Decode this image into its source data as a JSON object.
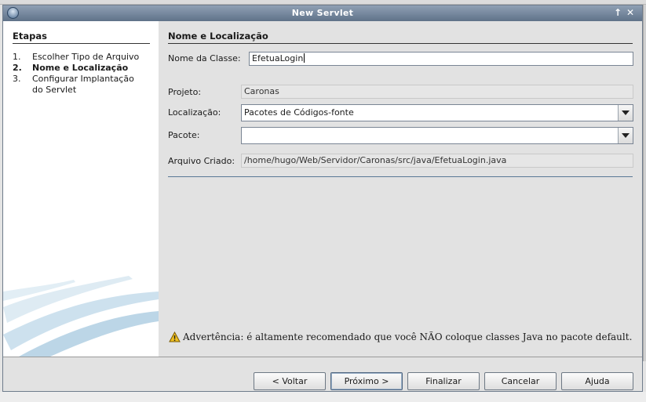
{
  "window": {
    "title": "New Servlet",
    "controls": {
      "maximize": "↑",
      "close": "✕"
    }
  },
  "steps": {
    "title": "Etapas",
    "items": [
      {
        "num": "1.",
        "lines": [
          "Escolher Tipo de Arquivo"
        ],
        "current": false
      },
      {
        "num": "2.",
        "lines": [
          "Nome e Localização"
        ],
        "current": true
      },
      {
        "num": "3.",
        "lines": [
          "Configurar Implantação",
          "do Servlet"
        ],
        "current": false
      }
    ]
  },
  "main": {
    "section_title": "Nome e Localização",
    "class_name": {
      "label": "Nome da Classe:",
      "value": "EfetuaLogin"
    },
    "project": {
      "label": "Projeto:",
      "value": "Caronas"
    },
    "location": {
      "label": "Localização:",
      "value": "Pacotes de Códigos-fonte"
    },
    "package": {
      "label": "Pacote:",
      "value": ""
    },
    "created_file": {
      "label": "Arquivo Criado:",
      "value": "/home/hugo/Web/Servidor/Caronas/src/java/EfetuaLogin.java"
    },
    "warning": {
      "prefix": "Advertência:",
      "text": "é altamente recomendado que você NÃO coloque classes Java no pacote default."
    }
  },
  "buttons": {
    "back": "< Voltar",
    "next": "Próximo >",
    "finish": "Finalizar",
    "cancel": "Cancelar",
    "help": "Ajuda"
  },
  "colors": {
    "titlebar": "#6f8298",
    "warning": "#f0c020",
    "swoosh": "#bcd6e6"
  }
}
